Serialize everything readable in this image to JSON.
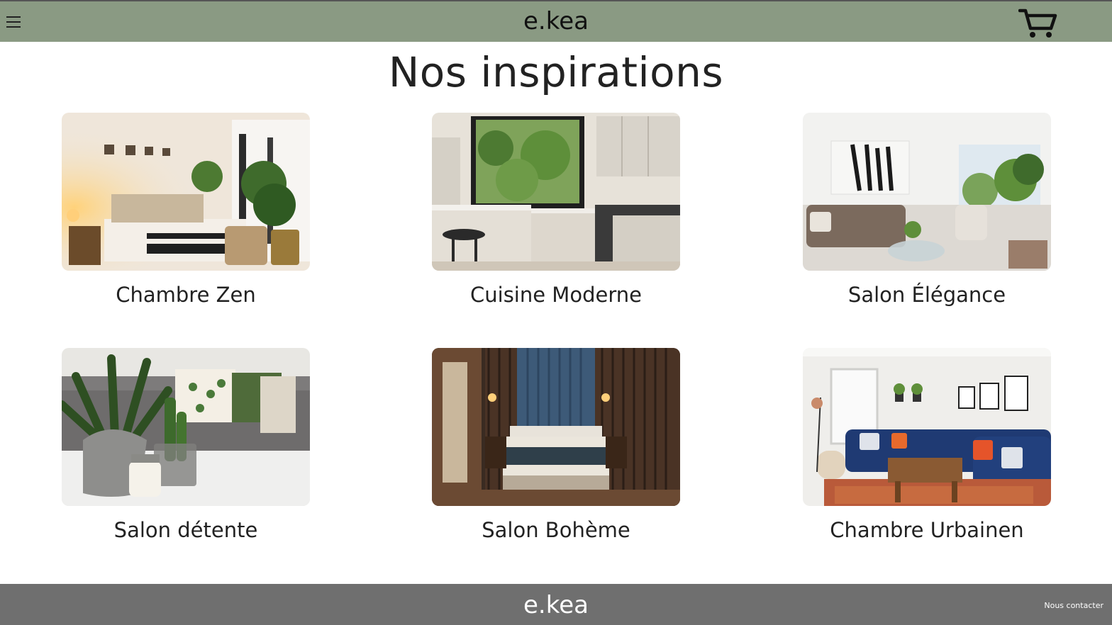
{
  "header": {
    "brand": "e.kea",
    "menu_icon": "hamburger-menu-icon",
    "cart_icon": "shopping-cart-icon",
    "background_color": "#8a9a83"
  },
  "main": {
    "title": "Nos inspirations",
    "cards": [
      {
        "label": "Chambre Zen"
      },
      {
        "label": "Cuisine Moderne"
      },
      {
        "label": "Salon Élégance"
      },
      {
        "label": "Salon détente"
      },
      {
        "label": "Salon Bohème"
      },
      {
        "label": "Chambre Urbainen"
      }
    ]
  },
  "footer": {
    "brand": "e.kea",
    "contact_link": "Nous contacter",
    "background_color": "#6f6f6f"
  }
}
